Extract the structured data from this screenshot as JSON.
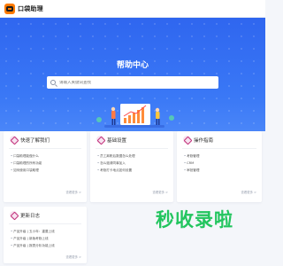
{
  "header": {
    "logo_text": "口袋助理",
    "logo_icon": "koudai-logo-icon"
  },
  "hero": {
    "title": "帮助中心",
    "search": {
      "placeholder": "请输入关键词查找",
      "icon": "search-icon"
    }
  },
  "cards": [
    {
      "title": "快速了解我们",
      "icon": "diamond-icon",
      "items": [
        "口袋助理能做什么",
        "口袋助理的所有功能",
        "如何使用口袋助理"
      ],
      "more": "查看更多 >"
    },
    {
      "title": "基础设置",
      "icon": "diamond-icon",
      "items": [
        "员工离职后数据怎么处理",
        "怎么邀请同事加入",
        "考勤打卡地点如何设置"
      ],
      "more": "查看更多 >"
    },
    {
      "title": "操作指南",
      "icon": "diamond-icon",
      "items": [
        "考勤管理",
        "CRM",
        "审批管理"
      ],
      "more": "查看更多 >"
    },
    {
      "title": "更新日志",
      "icon": "diamond-icon",
      "items": [
        "产品升级 | 五小年：重要上线",
        "产品升级 | 新版考勤上线",
        "产品升级 | 报表分析功能上线"
      ],
      "more": "查看更多 >"
    }
  ],
  "watermark": "秒收录啦",
  "colors": {
    "primary": "#2f66ef",
    "accent": "#c2307a",
    "watermark": "#22c55e",
    "logo": "#ff7a00"
  }
}
